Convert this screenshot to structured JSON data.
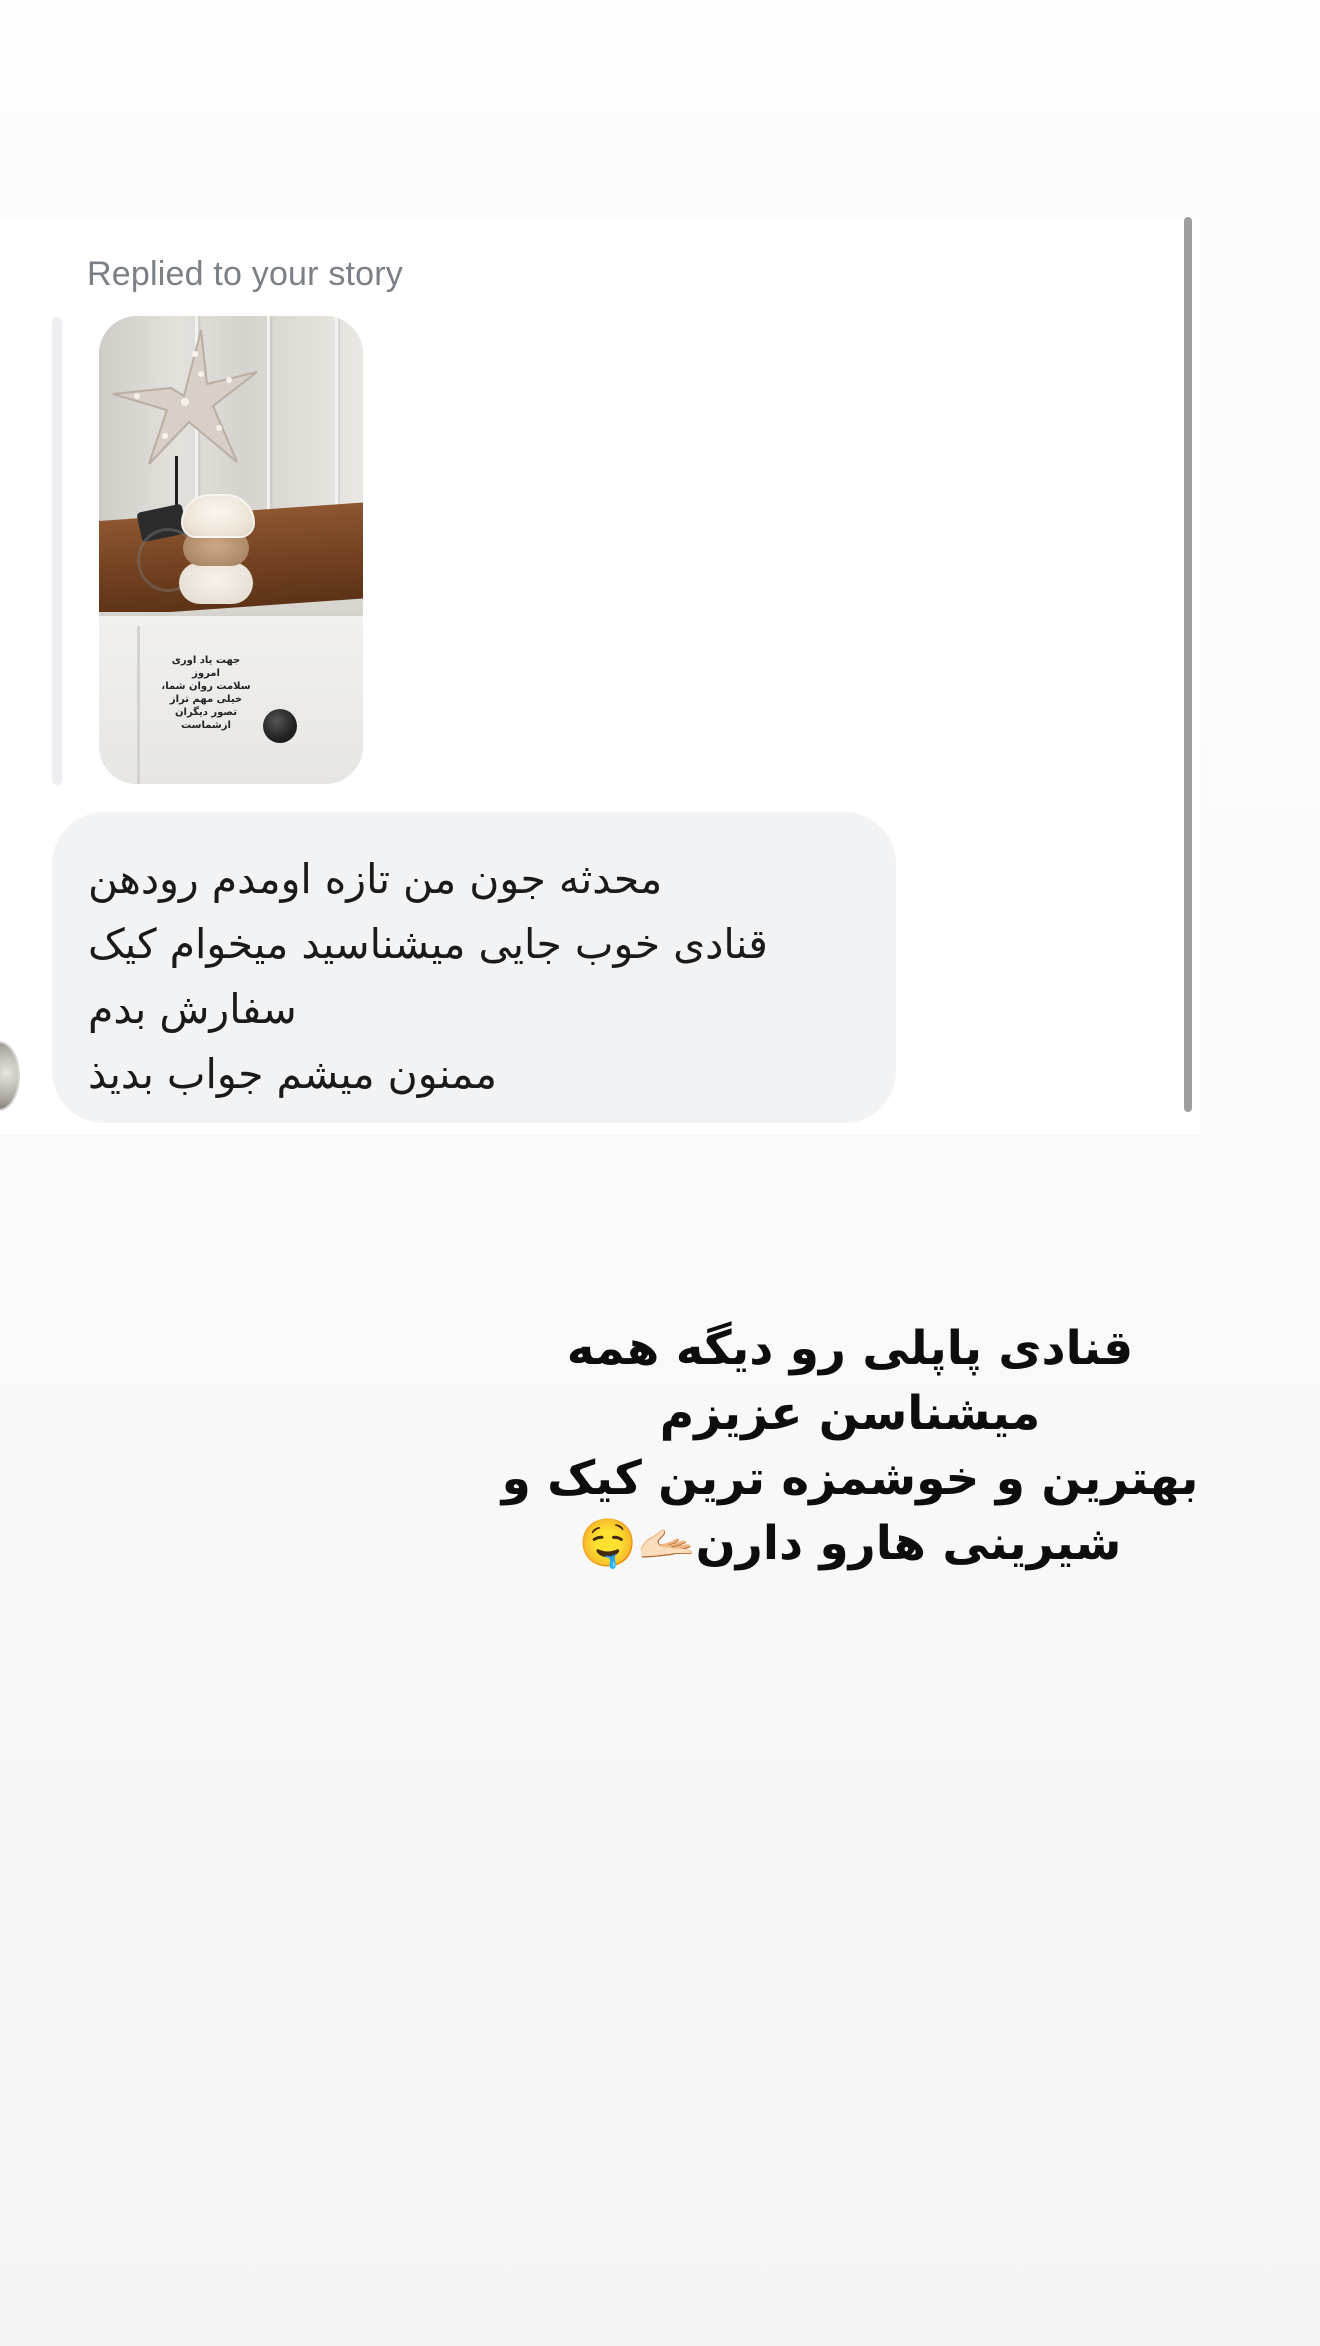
{
  "dm": {
    "replied_label": "Replied to your story",
    "story_thumbnail": {
      "caption_lines": [
        "جهت یاد اوری",
        "امروز",
        "سلامت روان شما،",
        "خیلی مهم تراز",
        "تصور دیگران",
        "ازشماست"
      ]
    },
    "message_lines": [
      "محدثه جون من تازه اومدم رودهن",
      "قنادی خوب جایی میشناسید میخوام کیک",
      "سفارش بدم",
      "ممنون میشم جواب بدیذ"
    ]
  },
  "story_caption": {
    "lines": [
      "قنادی پاپلی رو دیگه همه",
      "میشناسن عزیزم",
      "بهترین و خوشمزه ترین کیک و",
      "شیرینی هارو دارن🫴🏻🤤"
    ]
  }
}
